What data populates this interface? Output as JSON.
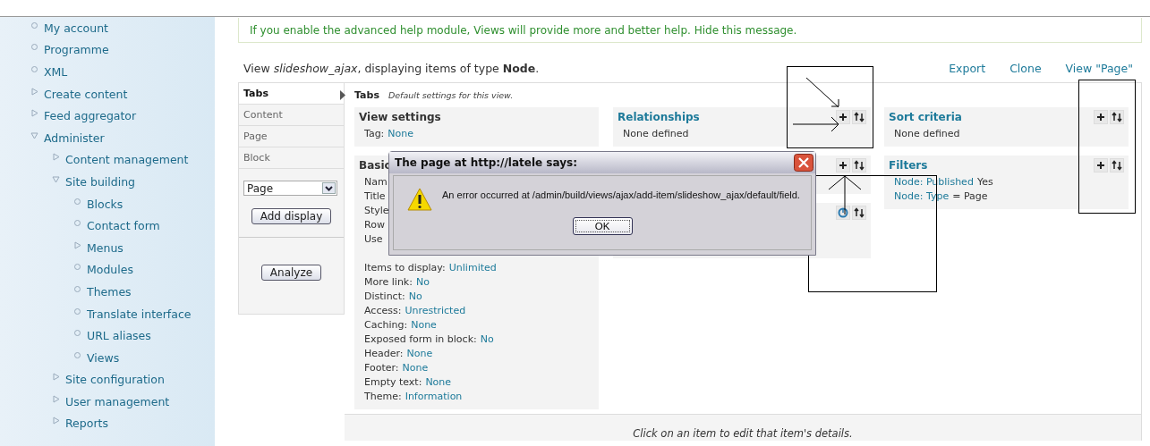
{
  "sidebar": {
    "items": [
      {
        "label": "My account",
        "kind": "leaf"
      },
      {
        "label": "Programme",
        "kind": "leaf"
      },
      {
        "label": "XML",
        "kind": "leaf"
      },
      {
        "label": "Create content",
        "kind": "branch",
        "expanded": false
      },
      {
        "label": "Feed aggregator",
        "kind": "branch",
        "expanded": false
      },
      {
        "label": "Administer",
        "kind": "branch",
        "expanded": true,
        "children": [
          {
            "label": "Content management",
            "kind": "branch",
            "expanded": false
          },
          {
            "label": "Site building",
            "kind": "branch",
            "expanded": true,
            "children": [
              {
                "label": "Blocks",
                "kind": "leaf"
              },
              {
                "label": "Contact form",
                "kind": "leaf"
              },
              {
                "label": "Menus",
                "kind": "branch",
                "expanded": false
              },
              {
                "label": "Modules",
                "kind": "leaf"
              },
              {
                "label": "Themes",
                "kind": "leaf"
              },
              {
                "label": "Translate interface",
                "kind": "leaf"
              },
              {
                "label": "URL aliases",
                "kind": "leaf"
              },
              {
                "label": "Views",
                "kind": "leaf"
              }
            ]
          },
          {
            "label": "Site configuration",
            "kind": "branch",
            "expanded": false
          },
          {
            "label": "User management",
            "kind": "branch",
            "expanded": false
          },
          {
            "label": "Reports",
            "kind": "branch",
            "expanded": false
          }
        ]
      }
    ]
  },
  "message": {
    "text": "If you enable the advanced help module, Views will provide more and better help.",
    "link": "Hide this message."
  },
  "view_header": {
    "text": "View *slideshow_ajax*, displaying items of type **Node**.",
    "links": [
      "Export",
      "Clone",
      "View \"Page\""
    ]
  },
  "displays": {
    "tabs": [
      {
        "label": "Tabs",
        "selected": true
      },
      {
        "label": "Content",
        "selected": false
      },
      {
        "label": "Page",
        "selected": false
      },
      {
        "label": "Block",
        "selected": false
      }
    ],
    "select": {
      "value": "Page"
    },
    "add_button": "Add display",
    "analyze_button": "Analyze"
  },
  "main": {
    "title": "Tabs",
    "subtitle": "Default settings for this view.",
    "columns": [
      [
        {
          "title": "View settings",
          "rows": [
            [
              {
                "text": "Tag:",
                "kind": "text"
              },
              {
                "text": "None",
                "kind": "link"
              }
            ]
          ]
        },
        {
          "title": "Basic",
          "rows": [
            [
              {
                "text": "Nam",
                "kind": "text"
              }
            ],
            [
              {
                "text": "Title",
                "kind": "text"
              }
            ],
            [
              {
                "text": "Style",
                "kind": "text"
              }
            ],
            [
              {
                "text": "Row",
                "kind": "text"
              }
            ],
            [
              {
                "text": "Use",
                "kind": "text"
              }
            ],
            [
              {
                "text": "Items to display:",
                "kind": "text"
              },
              {
                "text": "Unlimited",
                "kind": "link"
              }
            ],
            [
              {
                "text": "More link:",
                "kind": "text"
              },
              {
                "text": "No",
                "kind": "link"
              }
            ],
            [
              {
                "text": "Distinct:",
                "kind": "text"
              },
              {
                "text": "No",
                "kind": "link"
              }
            ],
            [
              {
                "text": "Access:",
                "kind": "text"
              },
              {
                "text": "Unrestricted",
                "kind": "link"
              }
            ],
            [
              {
                "text": "Caching:",
                "kind": "text"
              },
              {
                "text": "None",
                "kind": "link"
              }
            ],
            [
              {
                "text": "Exposed form in block:",
                "kind": "text"
              },
              {
                "text": "No",
                "kind": "link"
              }
            ],
            [
              {
                "text": "Header:",
                "kind": "text"
              },
              {
                "text": "None",
                "kind": "link"
              }
            ],
            [
              {
                "text": "Footer:",
                "kind": "text"
              },
              {
                "text": "None",
                "kind": "link"
              }
            ],
            [
              {
                "text": "Empty text:",
                "kind": "text"
              },
              {
                "text": "None",
                "kind": "link"
              }
            ],
            [
              {
                "text": "Theme:",
                "kind": "text"
              },
              {
                "text": "Information",
                "kind": "link"
              }
            ]
          ]
        }
      ],
      [
        {
          "title": "Relationships",
          "buttons": [
            {
              "kind": "add"
            },
            {
              "kind": "rearrange"
            }
          ],
          "rows": [
            [
              {
                "text": "None defined",
                "kind": "text"
              }
            ]
          ]
        },
        {
          "buttons": [
            {
              "kind": "add"
            },
            {
              "kind": "rearrange"
            }
          ]
        },
        {
          "buttons": [
            {
              "kind": "loading"
            },
            {
              "kind": "rearrange"
            }
          ]
        }
      ],
      [
        {
          "title": "Sort criteria",
          "buttons": [
            {
              "kind": "add"
            },
            {
              "kind": "rearrange"
            }
          ],
          "rows": [
            [
              {
                "text": "None defined",
                "kind": "text"
              }
            ]
          ]
        },
        {
          "title": "Filters",
          "buttons": [
            {
              "kind": "add"
            },
            {
              "kind": "rearrange"
            }
          ],
          "rows": [
            [
              {
                "text": "Node: Published",
                "kind": "link"
              },
              {
                "text": "Yes",
                "kind": "text"
              }
            ],
            [
              {
                "text": "Node: Type",
                "kind": "link"
              },
              {
                "text": "= Page",
                "kind": "text"
              }
            ]
          ]
        }
      ]
    ]
  },
  "footer": "Click on an item to edit that item's details.",
  "dialog": {
    "title": "The page at http://latele says:",
    "message": "An error occurred at /admin/build/views/ajax/add-item/slideshow_ajax/default/field.",
    "button": "OK"
  }
}
